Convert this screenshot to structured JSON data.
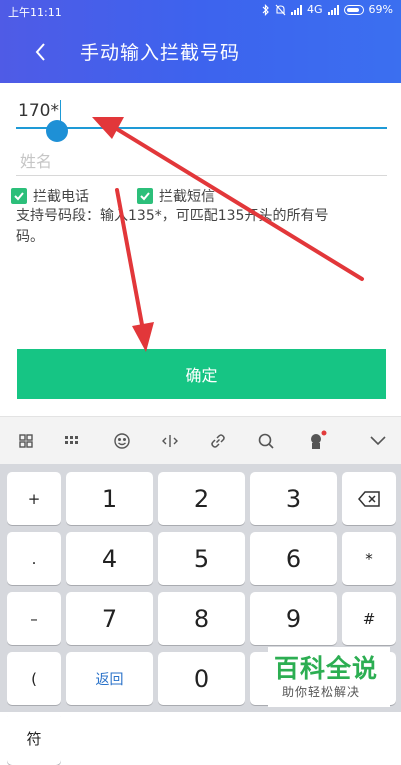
{
  "status_bar": {
    "time": "上午11:11",
    "network": "4G",
    "battery": "69%"
  },
  "header": {
    "title": "手动输入拦截号码"
  },
  "form": {
    "number_value": "170*",
    "name_placeholder": "姓名",
    "block_calls_label": "拦截电话",
    "block_sms_label": "拦截短信",
    "hint_line1": "支持号码段：输入135*，可匹配135开头的所有号",
    "hint_line2": "码。",
    "confirm_label": "确定"
  },
  "keyboard": {
    "side_left": [
      "+",
      ".",
      "–",
      "(",
      "符"
    ],
    "digits": [
      "1",
      "2",
      "3",
      "4",
      "5",
      "6",
      "7",
      "8",
      "9",
      "0"
    ],
    "side_right": [
      "*",
      "#"
    ],
    "back_label": "返回"
  },
  "watermark": {
    "brand": "百科全说",
    "slogan": "助你轻松解决"
  },
  "colors": {
    "header_blue": "#3d63ee",
    "accent_blue": "#1e9ad6",
    "confirm_green": "#16c584",
    "checkbox_green": "#2cbf7a",
    "arrow_red": "#e2373a"
  }
}
